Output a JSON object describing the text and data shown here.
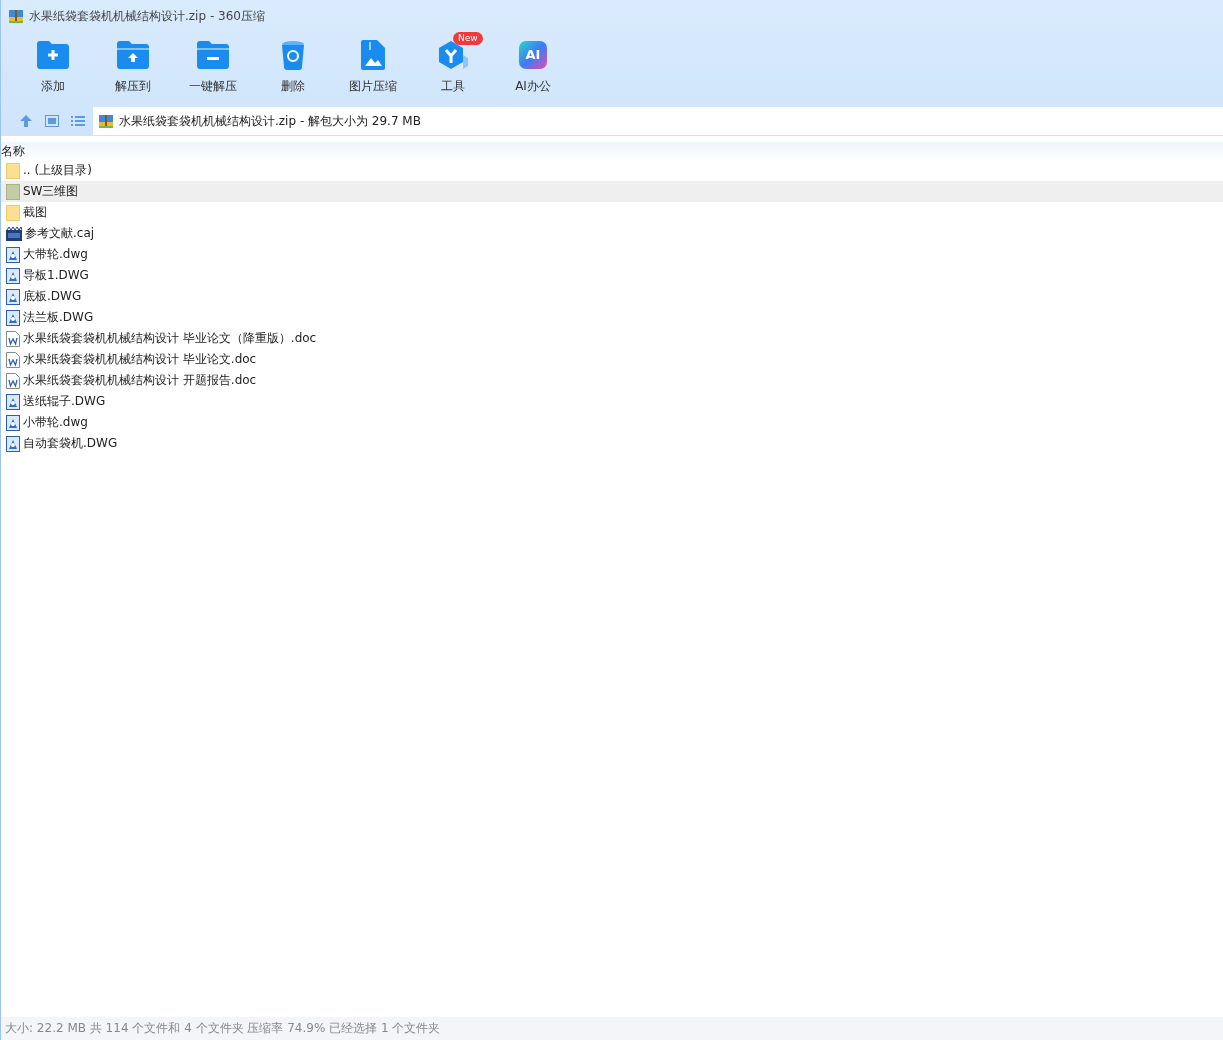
{
  "window": {
    "title": "水果纸袋套袋机机械结构设计.zip - 360压缩"
  },
  "toolbar": [
    {
      "kind": "add",
      "label": "添加"
    },
    {
      "kind": "extract",
      "label": "解压到"
    },
    {
      "kind": "oneclick",
      "label": "一键解压"
    },
    {
      "kind": "delete",
      "label": "删除"
    },
    {
      "kind": "image",
      "label": "图片压缩"
    },
    {
      "kind": "tools",
      "label": "工具",
      "badge": "New"
    },
    {
      "kind": "ai",
      "label": "AI办公",
      "icon_text": "AI"
    }
  ],
  "address": {
    "path": "水果纸袋套袋机机械结构设计.zip - 解包大小为 29.7 MB"
  },
  "table": {
    "columns": [
      "名称"
    ],
    "rows": [
      {
        "kind": "parent",
        "name": ".. (上级目录)",
        "selected": false
      },
      {
        "kind": "folder",
        "name": "SW三维图",
        "selected": true
      },
      {
        "kind": "folder",
        "name": "截图",
        "selected": false
      },
      {
        "kind": "caj",
        "name": "参考文献.caj",
        "selected": false
      },
      {
        "kind": "dwg",
        "name": "大带轮.dwg",
        "selected": false
      },
      {
        "kind": "dwg",
        "name": "导板1.DWG",
        "selected": false
      },
      {
        "kind": "dwg",
        "name": "底板.DWG",
        "selected": false
      },
      {
        "kind": "dwg",
        "name": "法兰板.DWG",
        "selected": false
      },
      {
        "kind": "doc",
        "name": "水果纸袋套袋机机械结构设计 毕业论文（降重版）.doc",
        "selected": false
      },
      {
        "kind": "doc",
        "name": "水果纸袋套袋机机械结构设计 毕业论文.doc",
        "selected": false
      },
      {
        "kind": "doc",
        "name": "水果纸袋套袋机机械结构设计 开题报告.doc",
        "selected": false
      },
      {
        "kind": "dwg",
        "name": "送纸辊子.DWG",
        "selected": false
      },
      {
        "kind": "dwg",
        "name": "小带轮.dwg",
        "selected": false
      },
      {
        "kind": "dwg",
        "name": "自动套袋机.DWG",
        "selected": false
      }
    ]
  },
  "status_bar": "大小: 22.2 MB 共 114 个文件和 4 个文件夹 压缩率 74.9% 已经选择 1 个文件夹"
}
